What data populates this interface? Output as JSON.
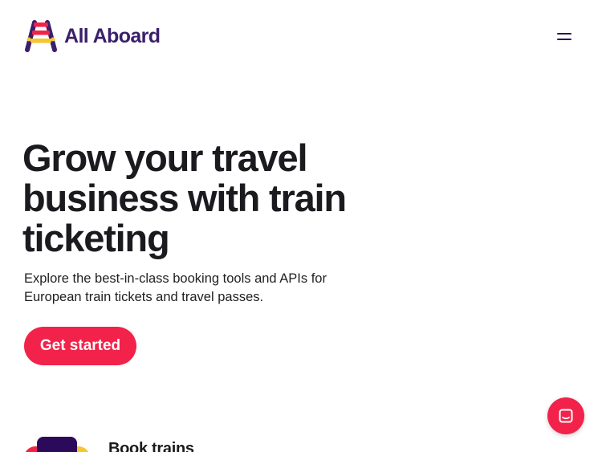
{
  "header": {
    "brand_name": "All Aboard",
    "logo_icon": "all-aboard-logo",
    "menu_icon": "hamburger-menu-icon"
  },
  "hero": {
    "title": "Grow your travel business with train ticketing",
    "subtitle": "Explore the best-in-class booking tools and APIs for European train tickets and travel passes.",
    "cta_label": "Get started"
  },
  "features": {
    "first_title": "Book trains",
    "first_icon": "ticket-illustration-icon"
  },
  "chat": {
    "icon": "chat-bubble-icon"
  },
  "colors": {
    "brand_red": "#f2224a",
    "brand_purple": "#3a1f6b",
    "brand_yellow": "#f7c531",
    "text_dark": "#1b1b1f"
  }
}
